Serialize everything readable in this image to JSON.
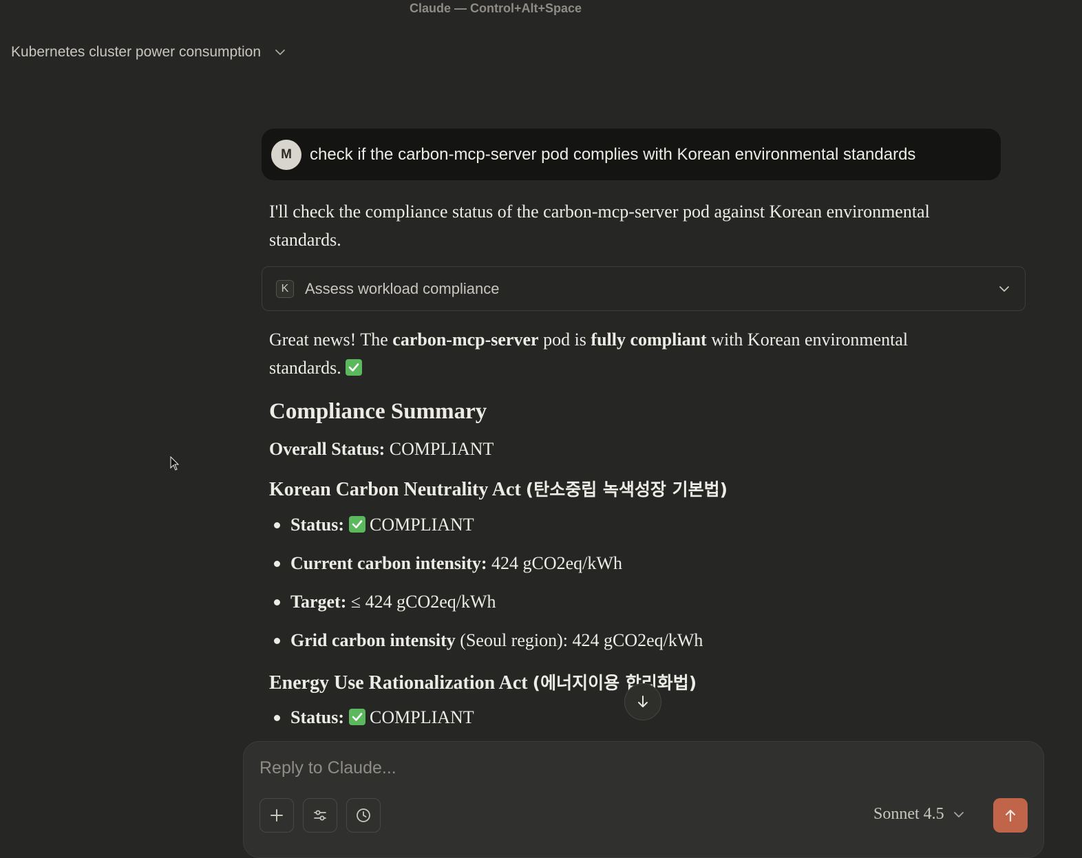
{
  "window": {
    "title": "Claude — Control+Alt+Space"
  },
  "conversation": {
    "title": "Kubernetes cluster power consumption"
  },
  "user_message": {
    "avatar_initial": "M",
    "text": "check if the carbon-mcp-server pod complies with Korean environmental standards"
  },
  "assistant": {
    "intro": "I'll check the compliance status of the carbon-mcp-server pod against Korean environmental standards.",
    "tool_call": {
      "icon_letter": "K",
      "label": "Assess workload compliance"
    },
    "result": {
      "p1_before": "Great news! The ",
      "p1_bold1": "carbon-mcp-server",
      "p1_mid": " pod is ",
      "p1_bold2": "fully compliant",
      "p1_after": " with Korean environmental standards."
    },
    "summary_heading": "Compliance Summary",
    "overall": {
      "label": "Overall Status:",
      "value": " COMPLIANT"
    },
    "sections": [
      {
        "heading_en": "Korean Carbon Neutrality Act ",
        "heading_ko": "(탄소중립 녹색성장 기본법)",
        "items": [
          {
            "label": "Status:",
            "value": "COMPLIANT"
          },
          {
            "label": "Current carbon intensity:",
            "value": " 424 gCO2eq/kWh"
          },
          {
            "label": "Target:",
            "value": " ≤ 424 gCO2eq/kWh"
          },
          {
            "label": "Grid carbon intensity",
            "value": " (Seoul region): 424 gCO2eq/kWh"
          }
        ]
      },
      {
        "heading_en": "Energy Use Rationalization Act ",
        "heading_ko": "(에너지이용 합리화법)",
        "items": [
          {
            "label": "Status:",
            "value": "COMPLIANT"
          }
        ]
      }
    ]
  },
  "composer": {
    "placeholder": "Reply to Claude...",
    "model": "Sonnet 4.5"
  },
  "colors": {
    "background": "#262624",
    "user_bubble": "#141413",
    "send_button": "#c0654a",
    "check_green": "#5cb85c"
  },
  "icons": [
    "chevron-down-icon",
    "check-icon",
    "arrow-down-icon",
    "plus-icon",
    "sliders-icon",
    "clock-icon",
    "arrow-up-icon",
    "cursor-icon"
  ]
}
